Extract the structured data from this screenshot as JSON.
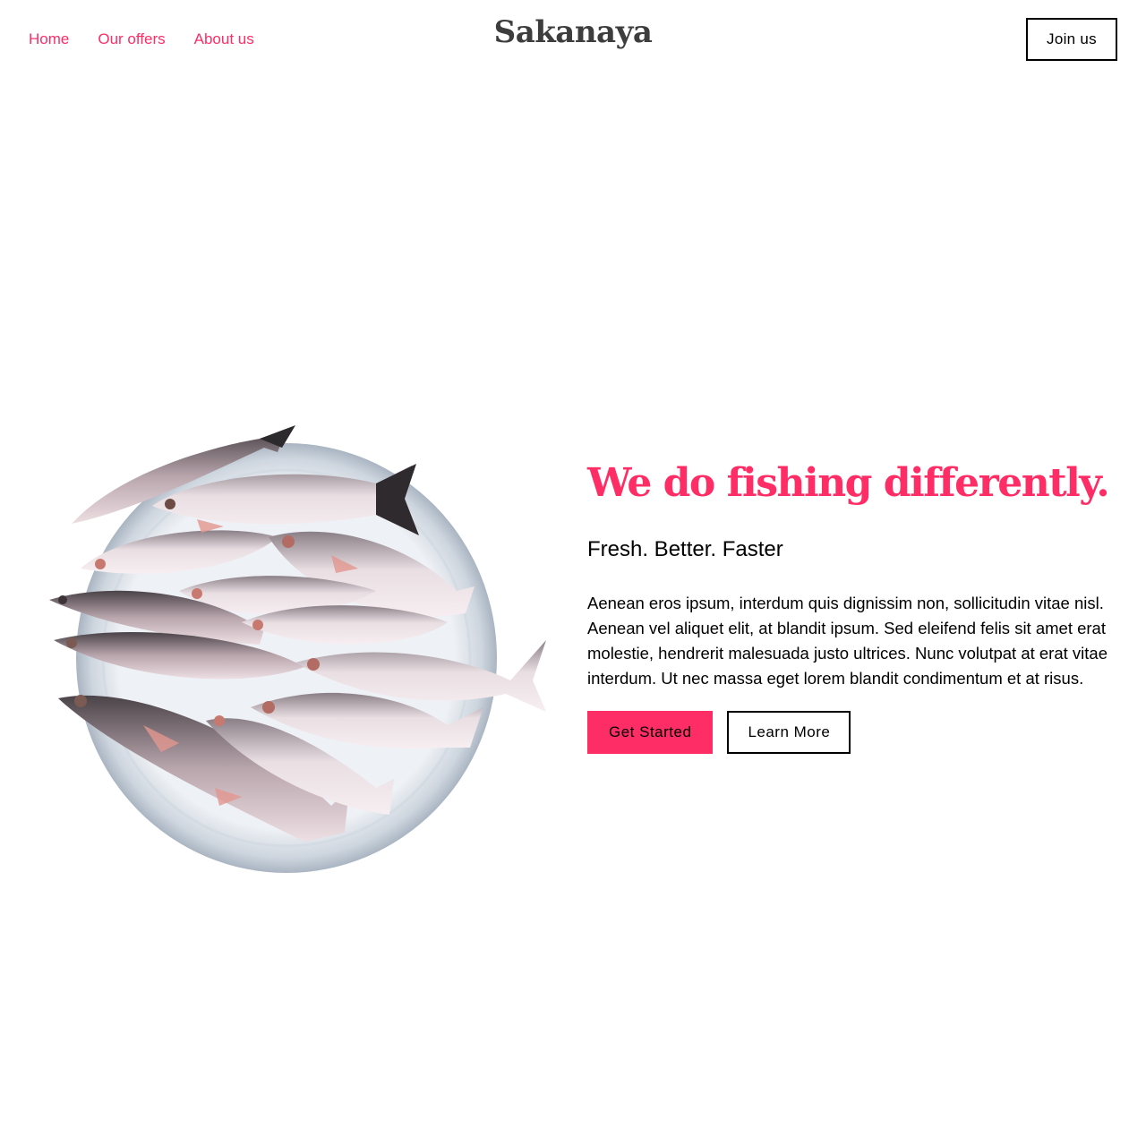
{
  "header": {
    "nav": [
      {
        "label": "Home"
      },
      {
        "label": "Our offers"
      },
      {
        "label": "About us"
      }
    ],
    "logo": "Sakanaya",
    "join_label": "Join us"
  },
  "hero": {
    "title": "We do fishing differently.",
    "subtitle": "Fresh. Better. Faster",
    "body": "Aenean eros ipsum, interdum quis dignissim non, sollicitudin vitae nisl. Aenean vel aliquet elit, at blandit ipsum. Sed eleifend felis sit amet erat molestie, hendrerit malesuada justo ultrices. Nunc volutpat at erat vitae interdum. Ut nec massa eget lorem blandit condimentum et at risus.",
    "primary_cta": "Get Started",
    "secondary_cta": "Learn More",
    "image_icon": "fish-plate-image"
  },
  "colors": {
    "accent": "#ff2d66",
    "logo": "#3d3d3d",
    "text": "#000000",
    "background": "#ffffff"
  }
}
